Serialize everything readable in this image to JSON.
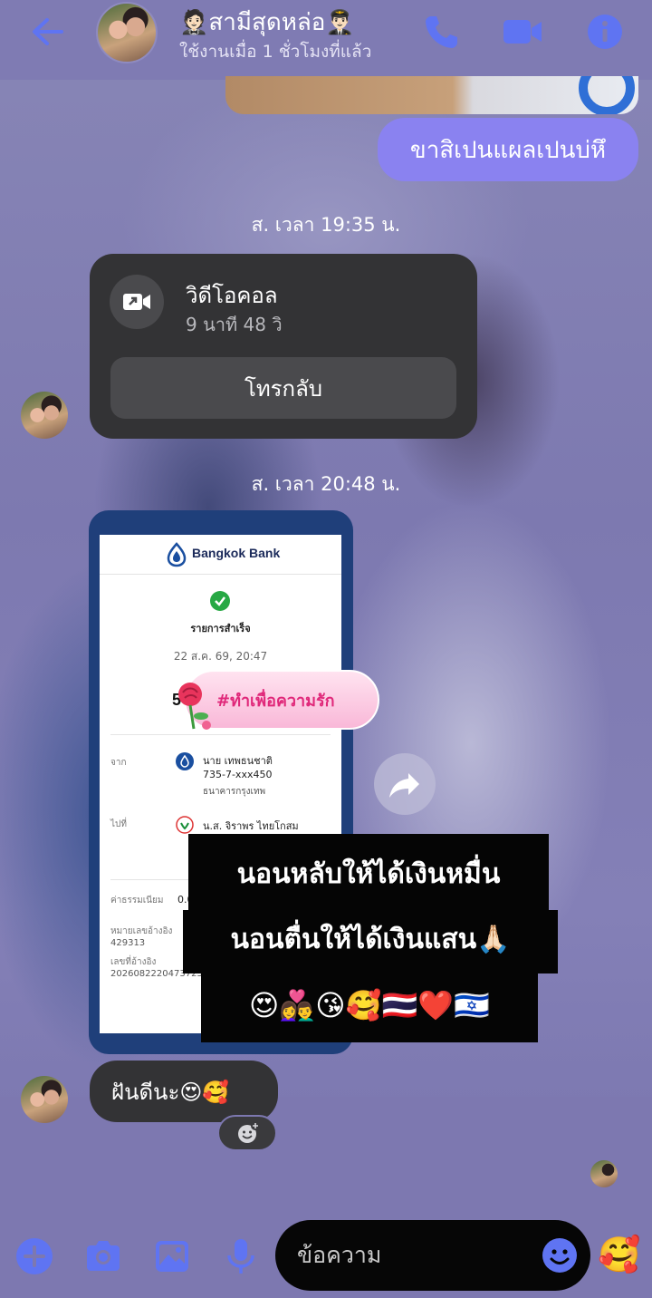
{
  "header": {
    "contact_name": "🤵🏻สามีสุดหล่อ👨🏻‍✈️",
    "status": "ใช้งานเมื่อ 1 ชั่วโมงที่แล้ว"
  },
  "messages": {
    "outgoing_text": "ขาสิเปนแผลเปนบ่หึ",
    "timestamp_1": "ส. เวลา 19:35 น.",
    "call": {
      "title": "วิดีโอคอล",
      "duration": "9 นาที 48 วิ",
      "call_back_label": "โทรกลับ"
    },
    "timestamp_2": "ส. เวลา 20:48 น.",
    "receipt": {
      "bank_name": "Bangkok Bank",
      "status": "รายการสำเร็จ",
      "date": "22 ส.ค. 69, 20:47",
      "amount_prefix": "5",
      "from_label": "จาก",
      "from_name": "นาย เทพธนชาติ",
      "from_account": "735-7-xxx450",
      "from_bank": "ธนาคารกรุงเทพ",
      "to_label": "ไปที่",
      "to_name": "น.ส. จิราพร ไทยโกสม",
      "fee_label": "ค่าธรรมเนียม",
      "fee_value": "0.0",
      "ref_label": "หมายเลขอ้างอิง",
      "ref_value": "429313",
      "ref2_label": "เลขที่อ้างอิง",
      "ref2_value": "2026082220473723"
    },
    "hashtag_sticker": "#ทำเพื่อความรัก",
    "caption_line1": "นอนหลับให้ได้เงินหมื่น",
    "caption_line2": "นอนตื่นให้ได้เงินแสน🙏🏻",
    "caption_line3": "😍👩‍❤️‍👨😘🥰🇹🇭❤️🇮🇱",
    "incoming_text": "ฝันดีนะ😍🥰"
  },
  "composer": {
    "placeholder": "ข้อความ",
    "quick_reaction": "🥰"
  },
  "colors": {
    "accent": "#8a82f0",
    "header_bg": "#7f7bb3",
    "bubble_in": "#333335",
    "icon": "#5f74f2"
  },
  "icons": [
    "back-arrow-icon",
    "phone-icon",
    "video-camera-icon",
    "info-icon",
    "video-call-icon",
    "share-icon",
    "add-reaction-icon",
    "plus-icon",
    "camera-icon",
    "gallery-icon",
    "microphone-icon",
    "emoji-icon"
  ]
}
